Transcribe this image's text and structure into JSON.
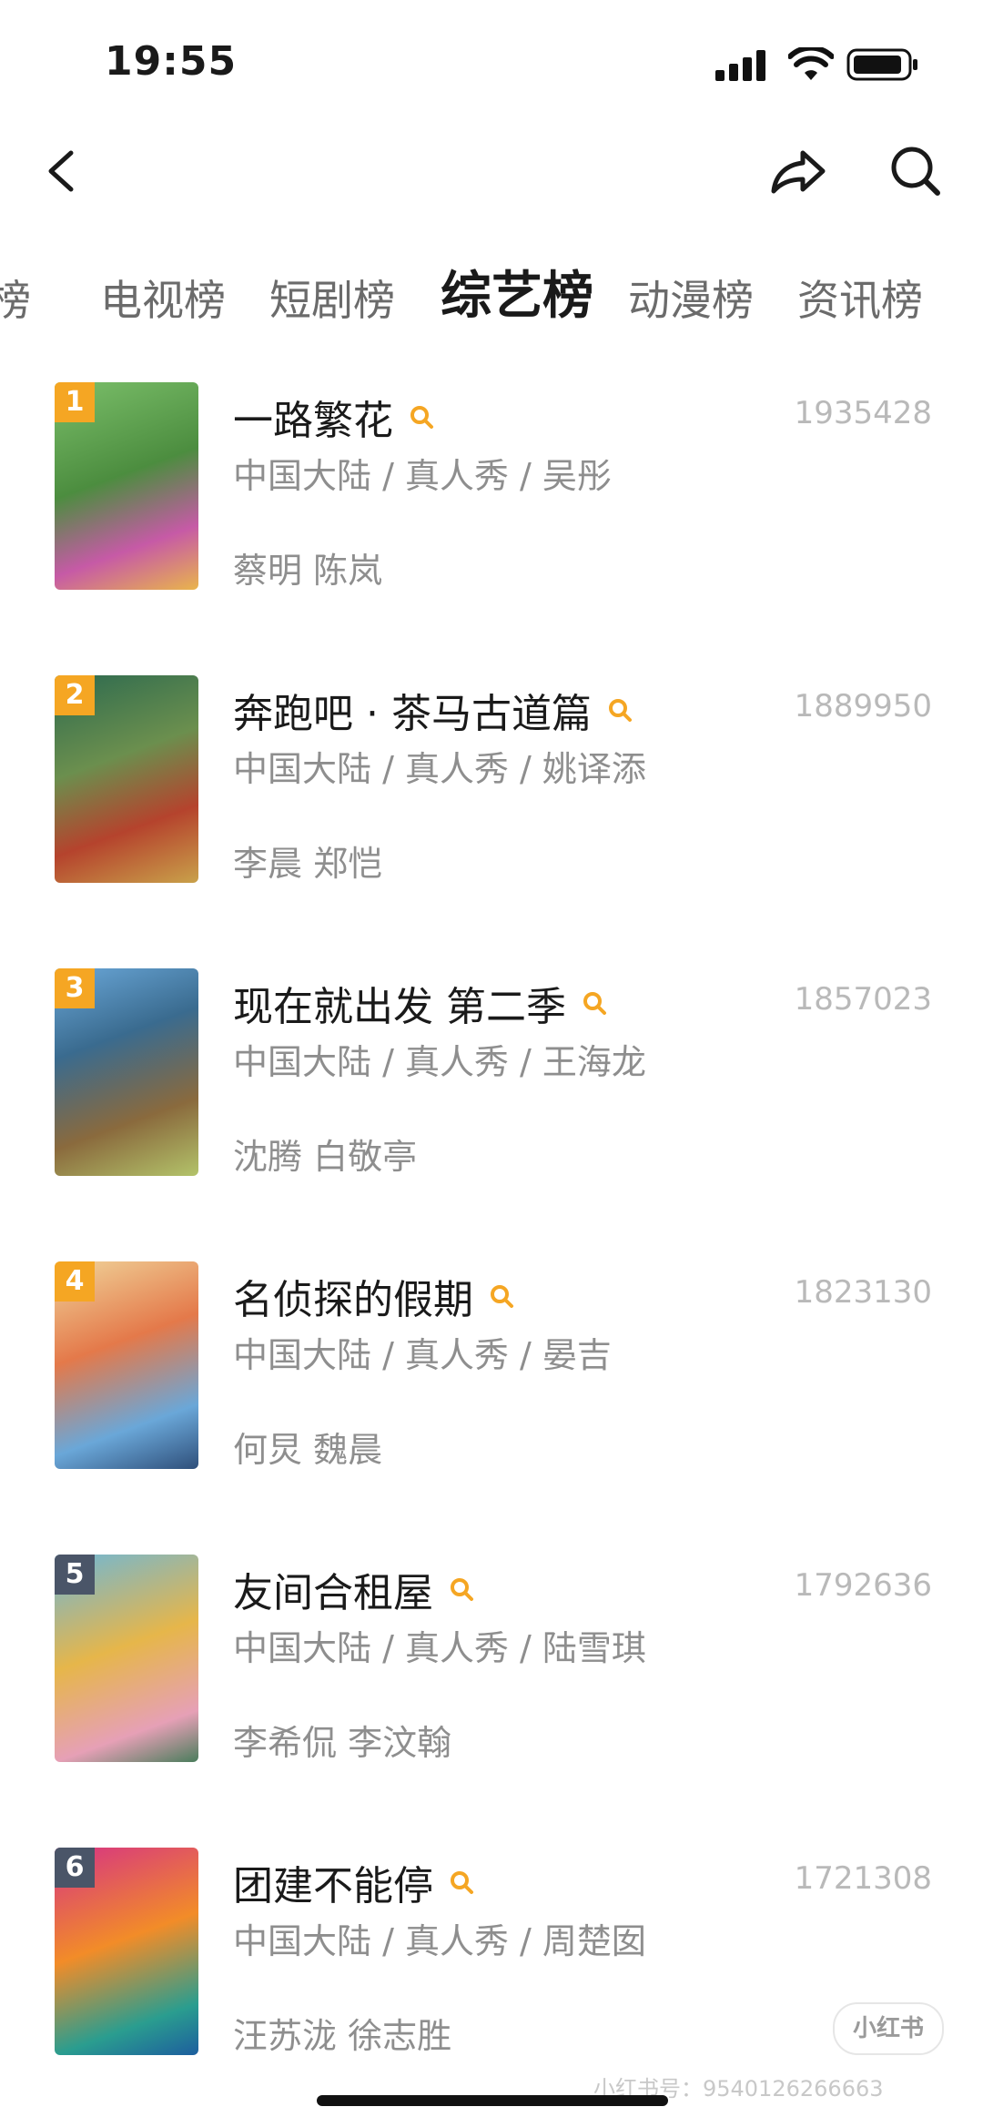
{
  "status": {
    "time": "19:55"
  },
  "tabs": [
    {
      "label": "榜",
      "active": false
    },
    {
      "label": "电视榜",
      "active": false
    },
    {
      "label": "短剧榜",
      "active": false
    },
    {
      "label": "综艺榜",
      "active": true
    },
    {
      "label": "动漫榜",
      "active": false
    },
    {
      "label": "资讯榜",
      "active": false
    }
  ],
  "items": [
    {
      "rank": "1",
      "title": "一路繁花",
      "score": "1935428",
      "meta": "中国大陆 / 真人秀 / 吴彤",
      "cast": "蔡明 陈岚",
      "rank_color": "#f5a623",
      "poster_colors": [
        "#4c8d3f",
        "#c65aa6",
        "#e9b44c"
      ]
    },
    {
      "rank": "2",
      "title": "奔跑吧 · 茶马古道篇",
      "score": "1889950",
      "meta": "中国大陆 / 真人秀 / 姚译添",
      "cast": "李晨 郑恺",
      "rank_color": "#f5a623",
      "poster_colors": [
        "#2d6a4f",
        "#b5432d",
        "#c9a14a"
      ]
    },
    {
      "rank": "3",
      "title": "现在就出发 第二季",
      "score": "1857023",
      "meta": "中国大陆 / 真人秀 / 王海龙",
      "cast": "沈腾 白敬亭",
      "rank_color": "#f5a623",
      "poster_colors": [
        "#3a6b8f",
        "#8a6a3d",
        "#b3c36a"
      ]
    },
    {
      "rank": "4",
      "title": "名侦探的假期",
      "score": "1823130",
      "meta": "中国大陆 / 真人秀 / 晏吉",
      "cast": "何炅 魏晨",
      "rank_color": "#f5a623",
      "poster_colors": [
        "#f0d49a",
        "#6aa7d8",
        "#e4794a"
      ]
    },
    {
      "rank": "5",
      "title": "友间合租屋",
      "score": "1792636",
      "meta": "中国大陆 / 真人秀 / 陆雪琪",
      "cast": "李希侃 李汶翰",
      "rank_color": "#4a5568",
      "poster_colors": [
        "#6fb7d6",
        "#e6b64a",
        "#e6a0b6"
      ]
    },
    {
      "rank": "6",
      "title": "团建不能停",
      "score": "1721308",
      "meta": "中国大陆 / 真人秀 / 周楚囡",
      "cast": "汪苏泷 徐志胜",
      "rank_color": "#4a5568",
      "poster_colors": [
        "#d63384",
        "#f28c28",
        "#2a9d8f"
      ]
    }
  ],
  "watermark": {
    "logo": "小红书",
    "id": "小红书号：9540126266663"
  },
  "icons": {
    "back": "chevron-left-icon",
    "share": "share-icon",
    "search": "search-icon"
  }
}
